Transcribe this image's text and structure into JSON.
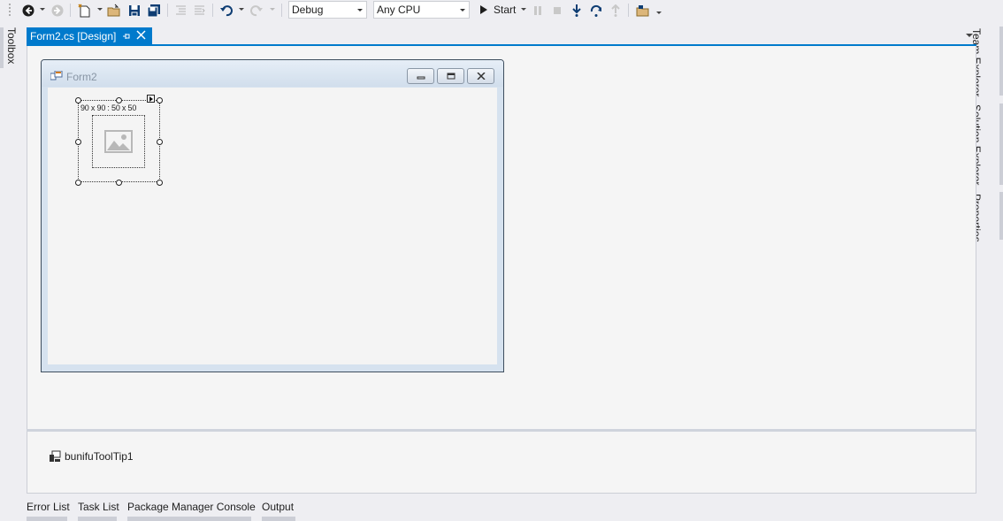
{
  "toolbar": {
    "configuration": "Debug",
    "platform": "Any CPU",
    "start_label": "Start",
    "icons": [
      "back-icon",
      "forward-icon",
      "new-project-icon",
      "open-file-icon",
      "save-icon",
      "save-all-icon",
      "comment-icon",
      "uncomment-icon",
      "undo-icon",
      "redo-icon",
      "start-icon",
      "pause-icon",
      "stop-icon",
      "step-into-icon",
      "step-over-icon",
      "step-out-icon",
      "find-icon"
    ]
  },
  "left_panel": {
    "toolbox_label": "Toolbox"
  },
  "right_panel": {
    "team_explorer_label": "Team Explorer",
    "solution_explorer_label": "Solution Explorer",
    "properties_label": "Properties"
  },
  "document": {
    "tab_title": "Form2.cs [Design]",
    "accent_color": "#007acc"
  },
  "form": {
    "title": "Form2",
    "picture_box_size_label": "90 x 90 : 50 x 50"
  },
  "component_tray": {
    "items": [
      {
        "label": "bunifuToolTip1"
      }
    ]
  },
  "bottom_tabs": [
    "Error List",
    "Task List",
    "Package Manager Console",
    "Output"
  ]
}
